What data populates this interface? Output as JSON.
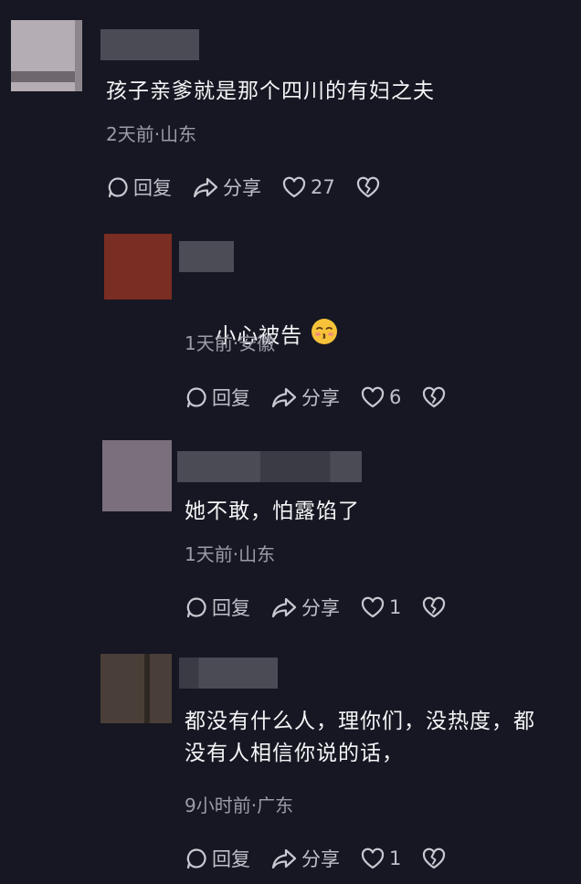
{
  "comments": [
    {
      "text": "孩子亲爹就是那个四川的有妇之夫",
      "meta": "2天前·山东",
      "reply_label": "回复",
      "share_label": "分享",
      "like_count": "27",
      "avatar_color": "#b4adb3"
    },
    {
      "text": "小心被告",
      "meta": "1天前·安徽",
      "reply_label": "回复",
      "share_label": "分享",
      "like_count": "6",
      "avatar_color": "#7a2d22"
    },
    {
      "text": "她不敢，怕露馅了",
      "meta": "1天前·山东",
      "reply_label": "回复",
      "share_label": "分享",
      "like_count": "1",
      "avatar_color": "#7b6f7c"
    },
    {
      "text": "都没有什么人，理你们，没热度，都\n没有人相信你说的话，",
      "meta": "9小时前·广东",
      "reply_label": "回复",
      "share_label": "分享",
      "like_count": "1",
      "avatar_color": "#4a3f38"
    }
  ],
  "icons": {
    "reply": "reply-icon",
    "share": "share-icon",
    "like": "heart-icon",
    "dislike": "broken-heart-icon",
    "emoji": "kissing-face-emoji"
  }
}
